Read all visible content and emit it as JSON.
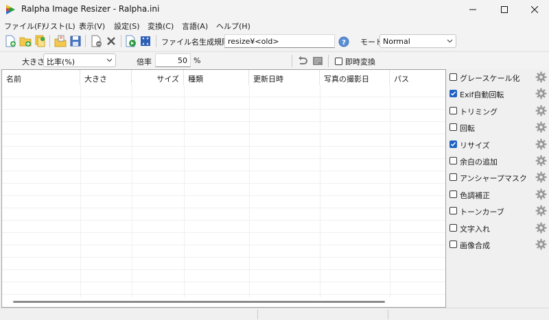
{
  "window": {
    "title": "Ralpha Image Resizer - Ralpha.ini"
  },
  "menu": [
    {
      "label": "ファイル(F)",
      "name": "menu-file"
    },
    {
      "label": "リスト(L)",
      "name": "menu-list"
    },
    {
      "label": "表示(V)",
      "name": "menu-view"
    },
    {
      "label": "設定(S)",
      "name": "menu-settings"
    },
    {
      "label": "変換(C)",
      "name": "menu-convert"
    },
    {
      "label": "言語(A)",
      "name": "menu-language"
    },
    {
      "label": "ヘルプ(H)",
      "name": "menu-help"
    }
  ],
  "toolbar": {
    "filename_rule_label": "ファイル名生成規則",
    "filename_rule_value": "resize¥<old>",
    "mode_label": "モード",
    "mode_value": "Normal"
  },
  "options": {
    "size_label": "大きさ",
    "size_value": "比率(%)",
    "ratio_label": "倍率",
    "ratio_value": "50",
    "ratio_unit": "%",
    "instant_convert_label": "即時変換",
    "instant_convert_checked": false
  },
  "table": {
    "columns": [
      "名前",
      "大きさ",
      "サイズ",
      "種類",
      "更新日時",
      "写真の撮影日",
      "パス"
    ]
  },
  "effects": [
    {
      "label": "グレースケール化",
      "checked": false
    },
    {
      "label": "Exif自動回転",
      "checked": true
    },
    {
      "label": "トリミング",
      "checked": false
    },
    {
      "label": "回転",
      "checked": false
    },
    {
      "label": "リサイズ",
      "checked": true
    },
    {
      "label": "余白の追加",
      "checked": false
    },
    {
      "label": "アンシャープマスク",
      "checked": false
    },
    {
      "label": "色調補正",
      "checked": false
    },
    {
      "label": "トーンカーブ",
      "checked": false
    },
    {
      "label": "文字入れ",
      "checked": false
    },
    {
      "label": "画像合成",
      "checked": false
    }
  ],
  "colors": {
    "accent": "#1f62c4",
    "window_bg": "#f0f0f0"
  }
}
